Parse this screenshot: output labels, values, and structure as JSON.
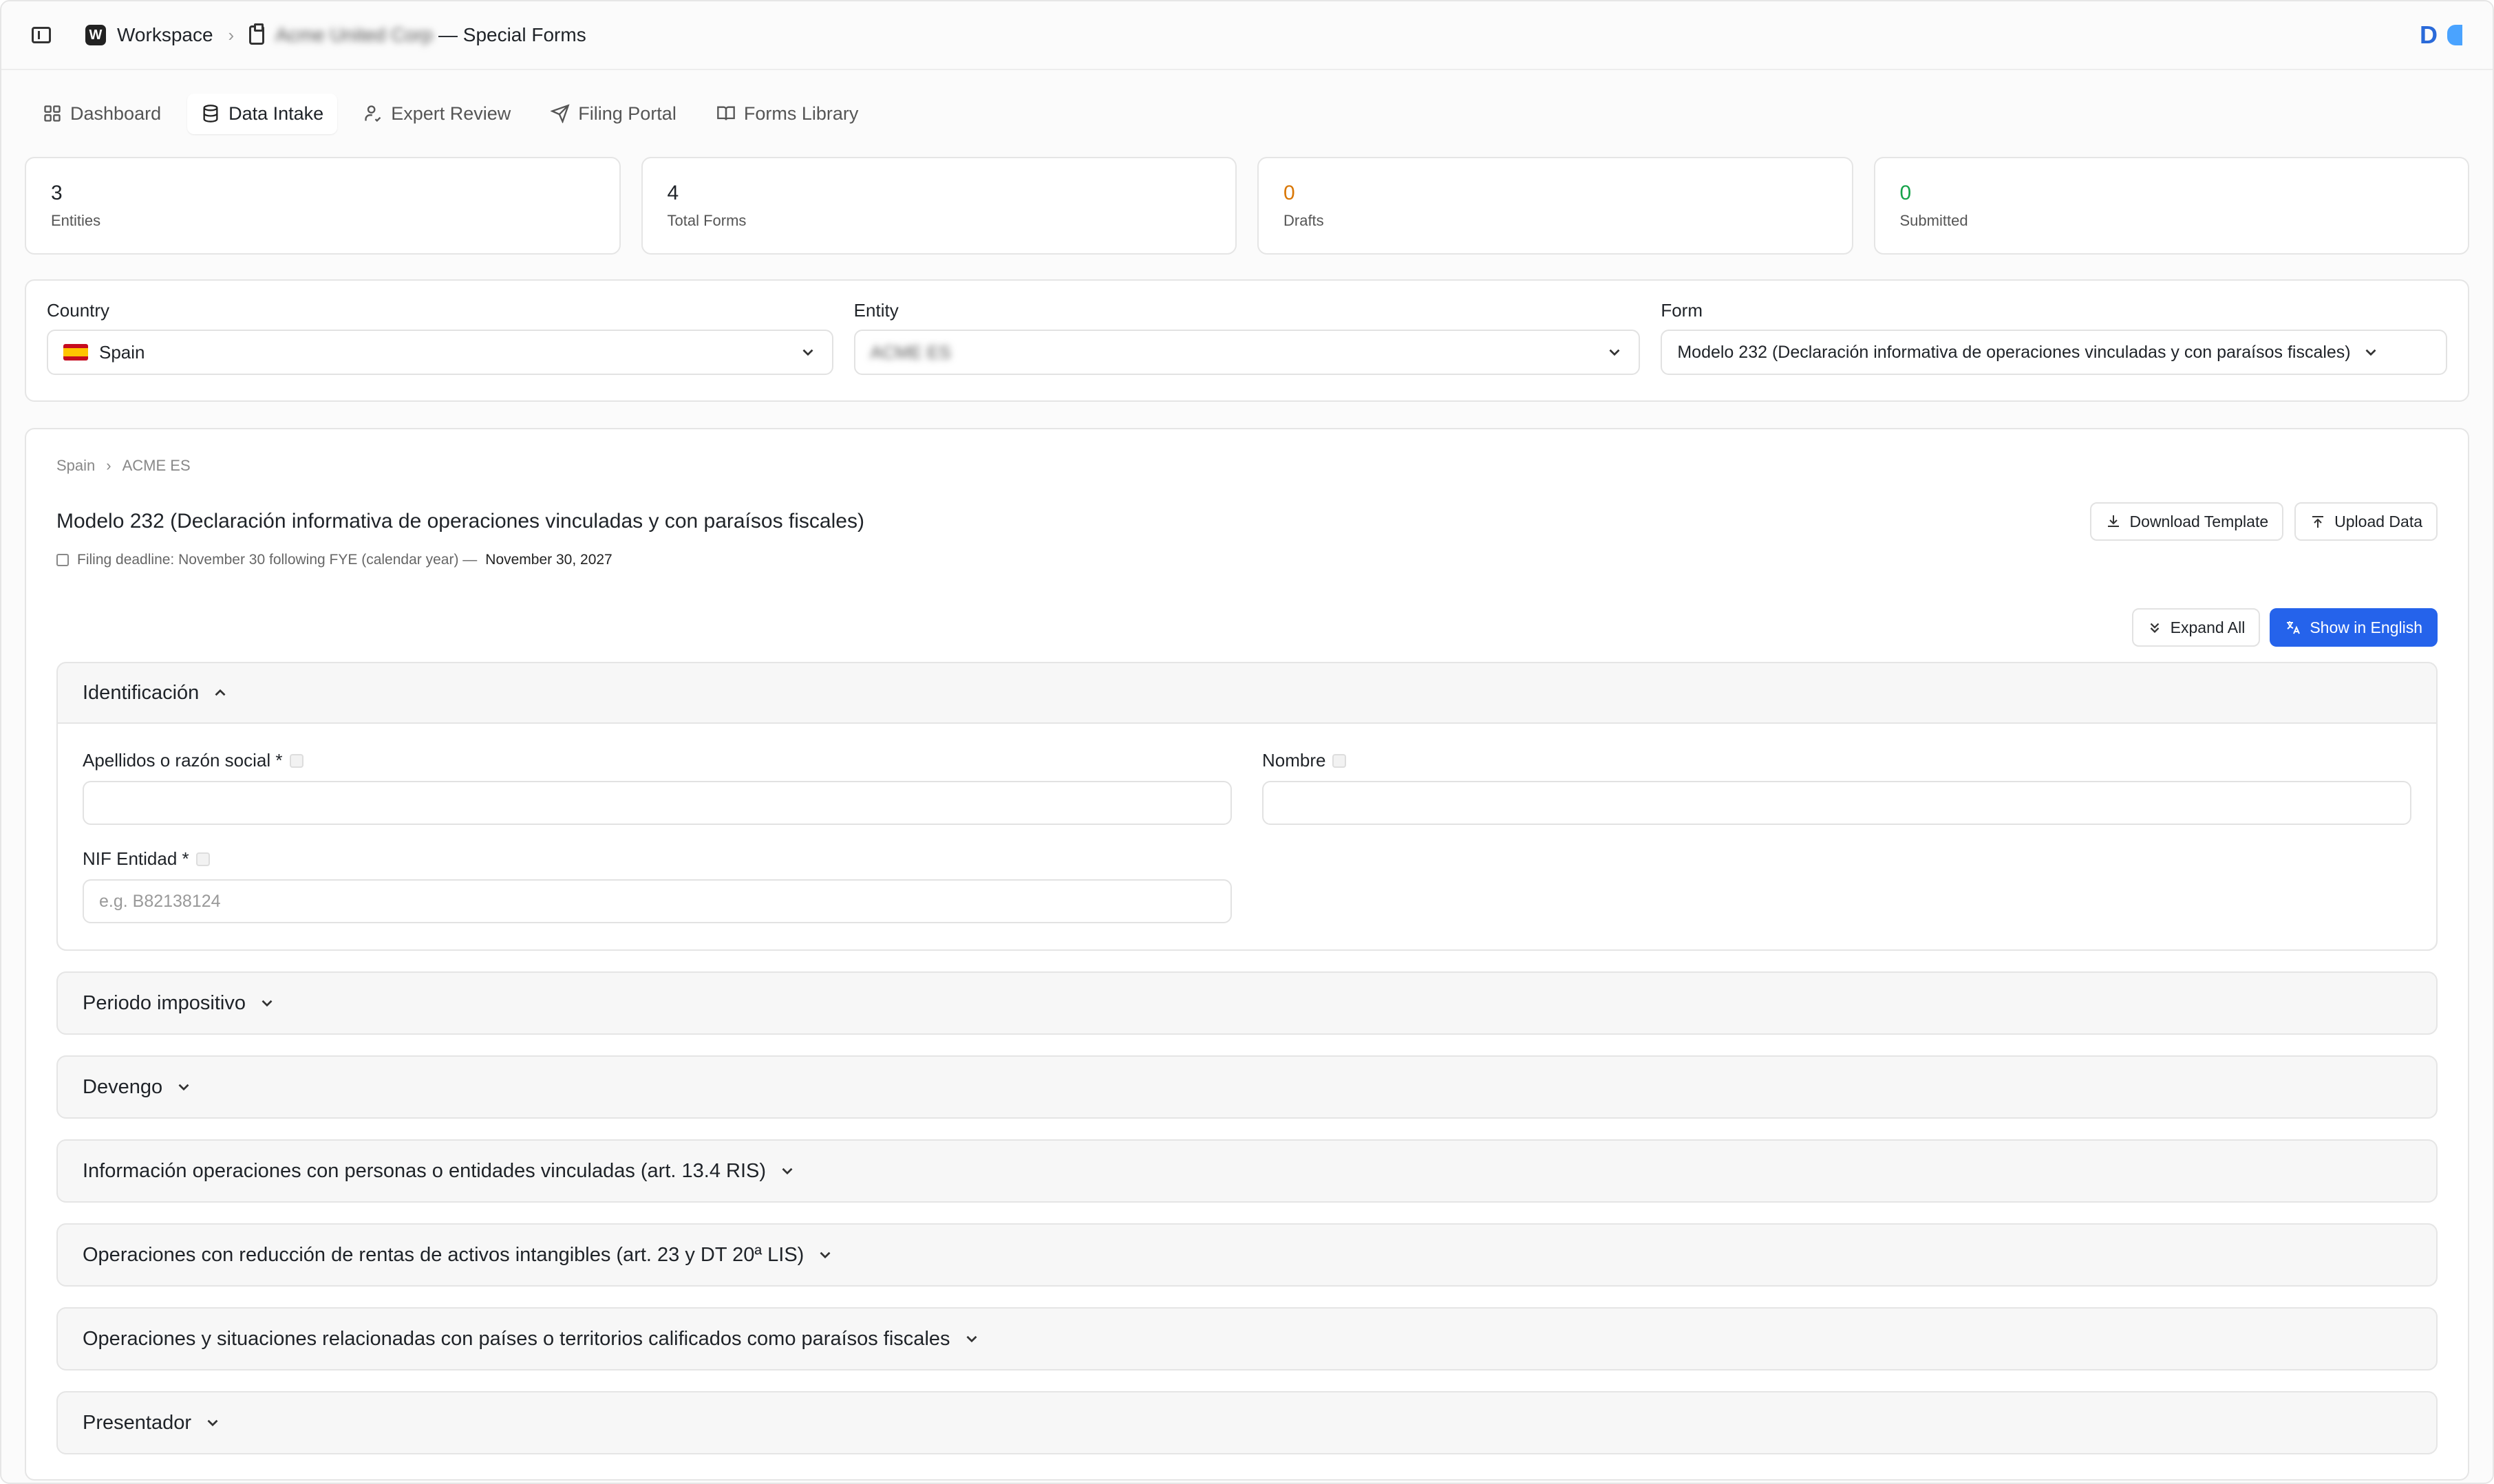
{
  "header": {
    "workspace_badge": "W",
    "workspace_label": "Workspace",
    "client_name": "Acme United Corp",
    "page_suffix": "— Special Forms",
    "user_initial": "D"
  },
  "tabs": [
    {
      "label": "Dashboard",
      "icon": "dashboard-icon"
    },
    {
      "label": "Data Intake",
      "icon": "database-icon"
    },
    {
      "label": "Expert Review",
      "icon": "user-check-icon"
    },
    {
      "label": "Filing Portal",
      "icon": "send-icon"
    },
    {
      "label": "Forms Library",
      "icon": "book-icon"
    }
  ],
  "stats": [
    {
      "value": "3",
      "label": "Entities"
    },
    {
      "value": "4",
      "label": "Total Forms"
    },
    {
      "value": "0",
      "label": "Drafts",
      "color": "#d97706"
    },
    {
      "value": "0",
      "label": "Submitted",
      "color": "#16a34a"
    }
  ],
  "selectors": {
    "country_label": "Country",
    "country_value": "Spain",
    "entity_label": "Entity",
    "entity_value": "ACME ES",
    "form_label": "Form",
    "form_value": "Modelo 232 (Declaración informativa de operaciones vinculadas y con paraísos fiscales)"
  },
  "main": {
    "breadcrumb_country": "Spain",
    "breadcrumb_entity": "ACME ES",
    "title": "Modelo 232 (Declaración informativa de operaciones vinculadas y con paraísos fiscales)",
    "deadline_text": "Filing deadline: November 30 following FYE (calendar year) —",
    "deadline_date": "November 30, 2027",
    "download_label": "Download Template",
    "upload_label": "Upload Data",
    "expand_label": "Expand All",
    "translate_label": "Show in English"
  },
  "section_open": {
    "title": "Identificación",
    "fields": {
      "apellidos_label": "Apellidos o razón social *",
      "nombre_label": "Nombre",
      "nif_label": "NIF Entidad *",
      "nif_placeholder": "e.g. B82138124"
    }
  },
  "sections": [
    {
      "title": "Periodo impositivo"
    },
    {
      "title": "Devengo"
    },
    {
      "title": "Información operaciones con personas o entidades vinculadas (art. 13.4 RIS)"
    },
    {
      "title": "Operaciones con reducción de rentas de activos intangibles (art. 23 y DT 20ª LIS)"
    },
    {
      "title": "Operaciones y situaciones relacionadas con países o territorios calificados como paraísos fiscales"
    },
    {
      "title": "Presentador"
    }
  ],
  "colors": {
    "accent": "#2563eb",
    "drafts": "#d97706",
    "submitted": "#16a34a"
  }
}
